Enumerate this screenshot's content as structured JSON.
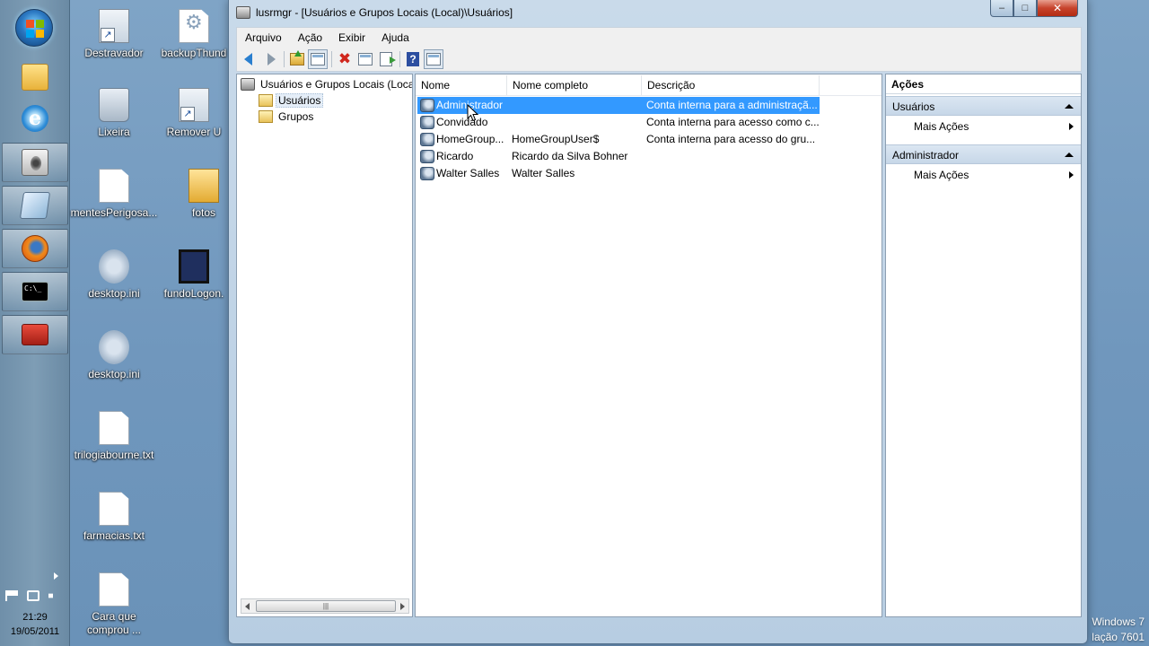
{
  "taskbar": {
    "clock": {
      "time": "21:29",
      "date": "19/05/2011"
    },
    "items": [
      {
        "name": "start-button",
        "icon": "windows-orb-icon"
      },
      {
        "name": "explorer",
        "icon": "folder-icon"
      },
      {
        "name": "internet-explorer",
        "icon": "ie-icon",
        "glyph": "e"
      },
      {
        "name": "media",
        "icon": "speaker-icon"
      },
      {
        "name": "notes",
        "icon": "notepad-icon"
      },
      {
        "name": "firefox",
        "icon": "firefox-icon"
      },
      {
        "name": "command-prompt",
        "icon": "cmd-icon",
        "glyph": "C:\\_"
      },
      {
        "name": "toolbox",
        "icon": "toolbox-icon"
      }
    ]
  },
  "desktop": {
    "icons": [
      {
        "label": "Destravador",
        "type": "shortcut"
      },
      {
        "label": "backupThund",
        "type": "gear"
      },
      {
        "label": "Lixeira",
        "type": "trash"
      },
      {
        "label": "Remover U",
        "type": "shortcut"
      },
      {
        "label": "mentesPerigosa...",
        "type": "doc"
      },
      {
        "label": "fotos",
        "type": "folder"
      },
      {
        "label": "desktop.ini",
        "type": "ini"
      },
      {
        "label": "fundoLogon.",
        "type": "video"
      },
      {
        "label": "desktop.ini",
        "type": "ini"
      },
      {
        "label": "trilogiabourne.txt",
        "type": "doc"
      },
      {
        "label": "farmacias.txt",
        "type": "doc"
      },
      {
        "label": "Cara que comprou ...",
        "type": "doc"
      }
    ],
    "watermark": {
      "line1": "Windows 7",
      "line2": "lação 7601"
    }
  },
  "window": {
    "title": "lusrmgr - [Usuários e Grupos Locais (Local)\\Usuários]",
    "controls": {
      "minimize": "–",
      "maximize": "□",
      "close": "✕"
    },
    "menu": [
      "Arquivo",
      "Ação",
      "Exibir",
      "Ajuda"
    ],
    "toolbar": [
      "back-icon",
      "forward-icon",
      "up-folder-icon",
      "show-hide-tree-icon",
      "delete-icon",
      "properties-icon",
      "export-icon",
      "help-icon",
      "show-hide-action-icon"
    ],
    "toolbar_help_glyph": "?",
    "toolbar_delete_glyph": "✖",
    "tree": {
      "root": "Usuários e Grupos Locais (Local)",
      "children": [
        "Usuários",
        "Grupos"
      ],
      "selected": "Usuários",
      "scroll_thumb_glyph": "|||"
    },
    "list": {
      "columns": [
        "Nome",
        "Nome completo",
        "Descrição"
      ],
      "rows": [
        {
          "name": "Administrador",
          "full_name": "",
          "description": "Conta interna para a administraçã...",
          "selected": true
        },
        {
          "name": "Convidado",
          "full_name": "",
          "description": "Conta interna para acesso como c...",
          "selected": false
        },
        {
          "name": "HomeGroup...",
          "full_name": "HomeGroupUser$",
          "description": "Conta interna para acesso do gru...",
          "selected": false
        },
        {
          "name": "Ricardo",
          "full_name": "Ricardo da Silva Bohner",
          "description": "",
          "selected": false
        },
        {
          "name": "Walter Salles",
          "full_name": "Walter Salles",
          "description": "",
          "selected": false
        }
      ]
    },
    "actions": {
      "title": "Ações",
      "sections": [
        {
          "header": "Usuários",
          "item": "Mais Ações"
        },
        {
          "header": "Administrador",
          "item": "Mais Ações"
        }
      ]
    }
  },
  "colors": {
    "selection": "#3399ff",
    "desktop": "#7097bd",
    "accent": "#2a7fcf"
  }
}
